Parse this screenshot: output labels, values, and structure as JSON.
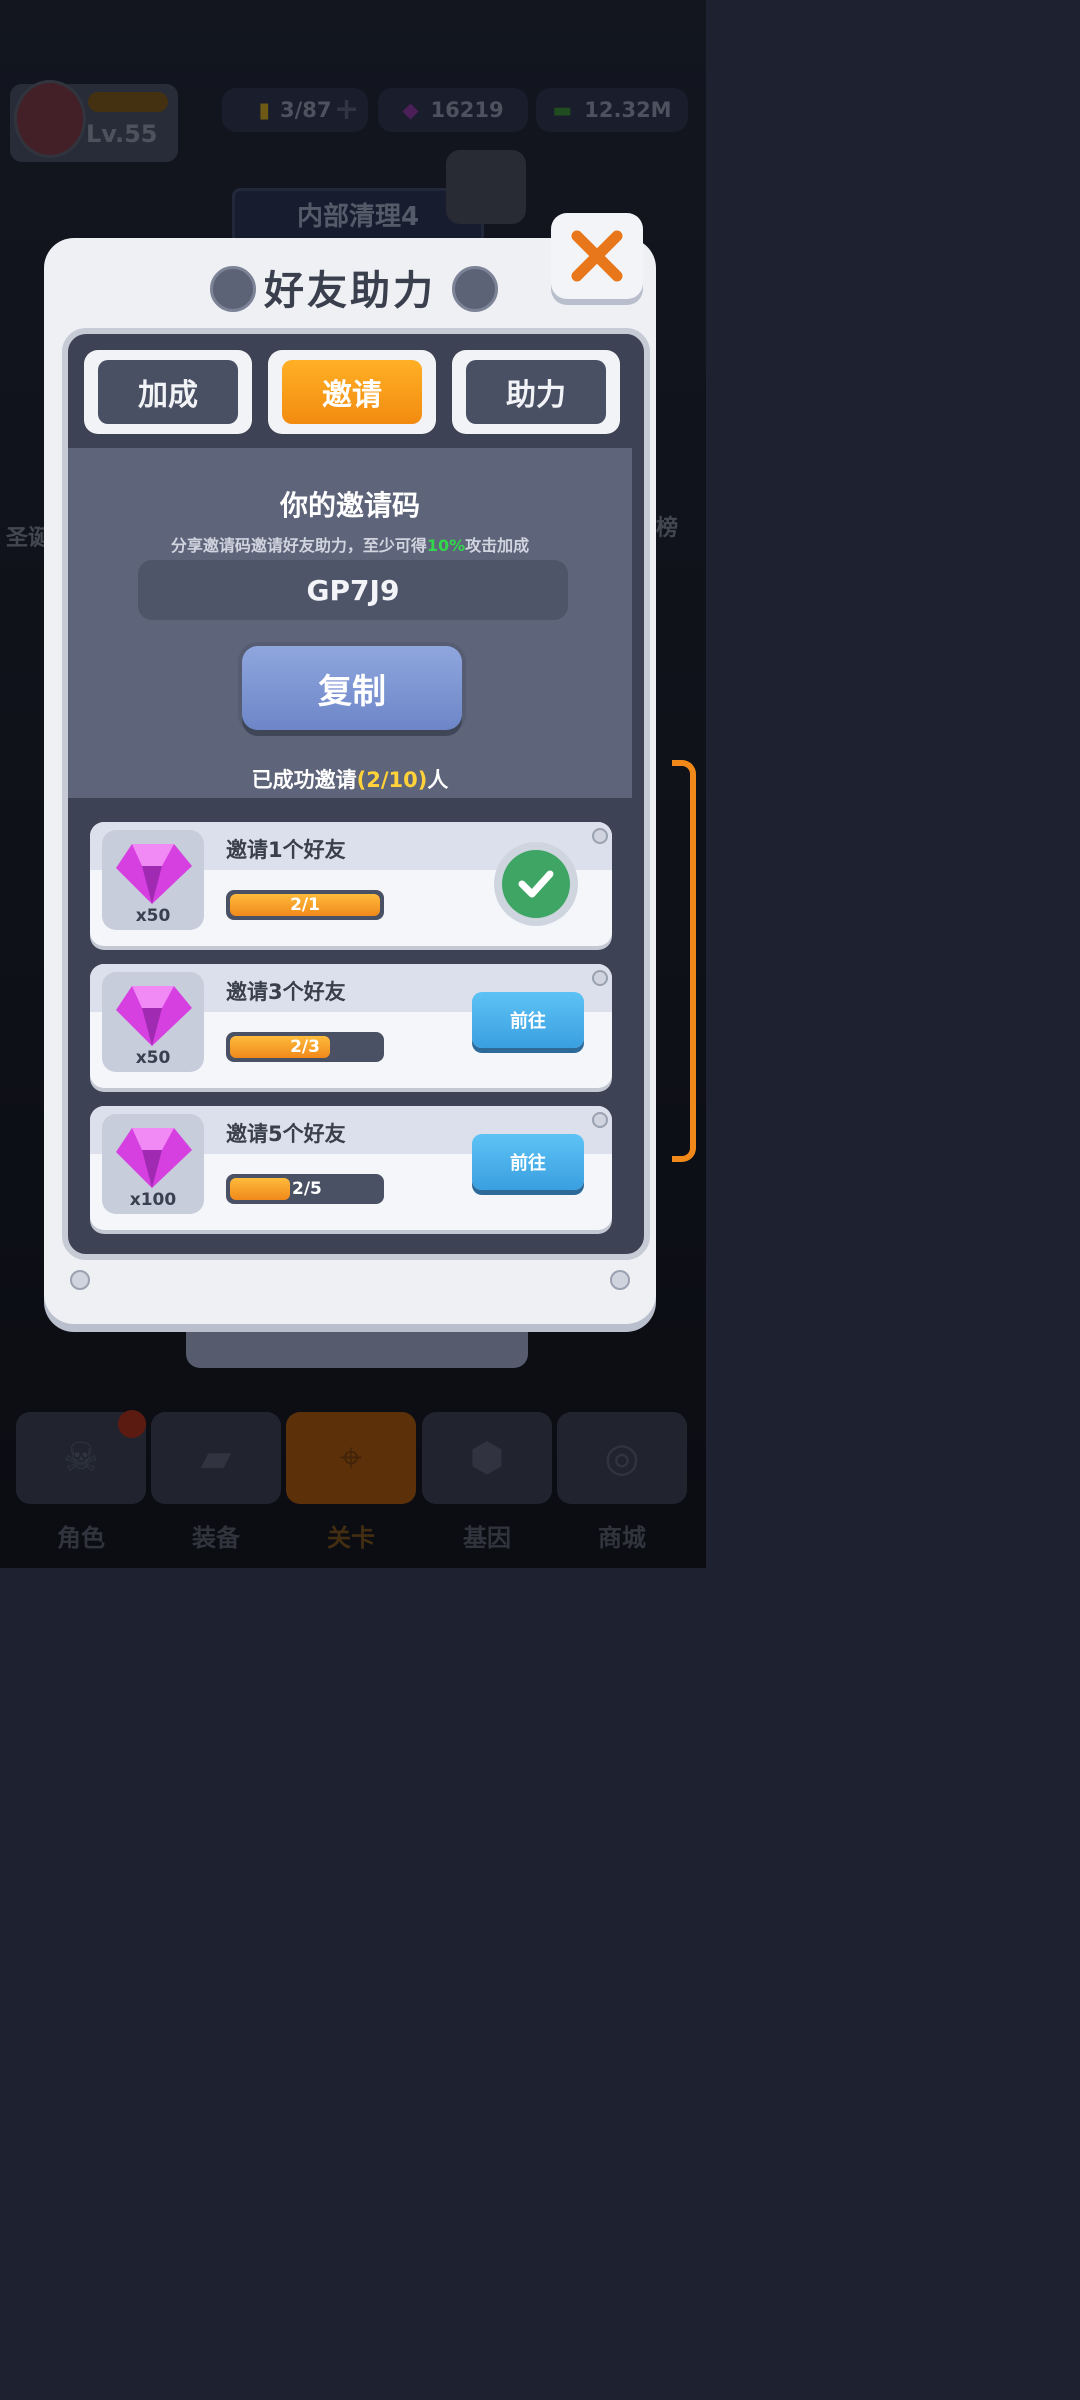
{
  "hud": {
    "level": "Lv.55",
    "energy": "3/87",
    "gems": "16219",
    "cash": "12.32M",
    "stage_name": "内部清理4",
    "side_left_label": "圣诞",
    "side_right_label": "榜"
  },
  "dialog": {
    "title": "好友助力",
    "tabs": [
      {
        "label": "加成",
        "active": false
      },
      {
        "label": "邀请",
        "active": true
      },
      {
        "label": "助力",
        "active": false
      }
    ],
    "invite": {
      "heading": "你的邀请码",
      "desc_prefix": "分享邀请码邀请好友助力，至少可得",
      "desc_highlight": "10%",
      "desc_suffix": "攻击加成",
      "code": "GP7J9",
      "copy_label": "复制",
      "invited_prefix": "已成功邀请",
      "invited_count": "(2/10)",
      "invited_suffix": "人"
    },
    "rewards": [
      {
        "title": "邀请1个好友",
        "qty": "x50",
        "progress_text": "2/1",
        "progress": 1.0,
        "status": "done"
      },
      {
        "title": "邀请3个好友",
        "qty": "x50",
        "progress_text": "2/3",
        "progress": 0.6667,
        "status": "go",
        "button": "前往"
      },
      {
        "title": "邀请5个好友",
        "qty": "x100",
        "progress_text": "2/5",
        "progress": 0.4,
        "status": "go",
        "button": "前往"
      }
    ]
  },
  "nav": [
    {
      "label": "角色"
    },
    {
      "label": "装备"
    },
    {
      "label": "关卡"
    },
    {
      "label": "基因"
    },
    {
      "label": "商城"
    }
  ],
  "colors": {
    "accent_orange": "#f28b10",
    "go_blue": "#3a9fe0",
    "highlight_green": "#32d74b",
    "highlight_yellow": "#ffd23a"
  }
}
